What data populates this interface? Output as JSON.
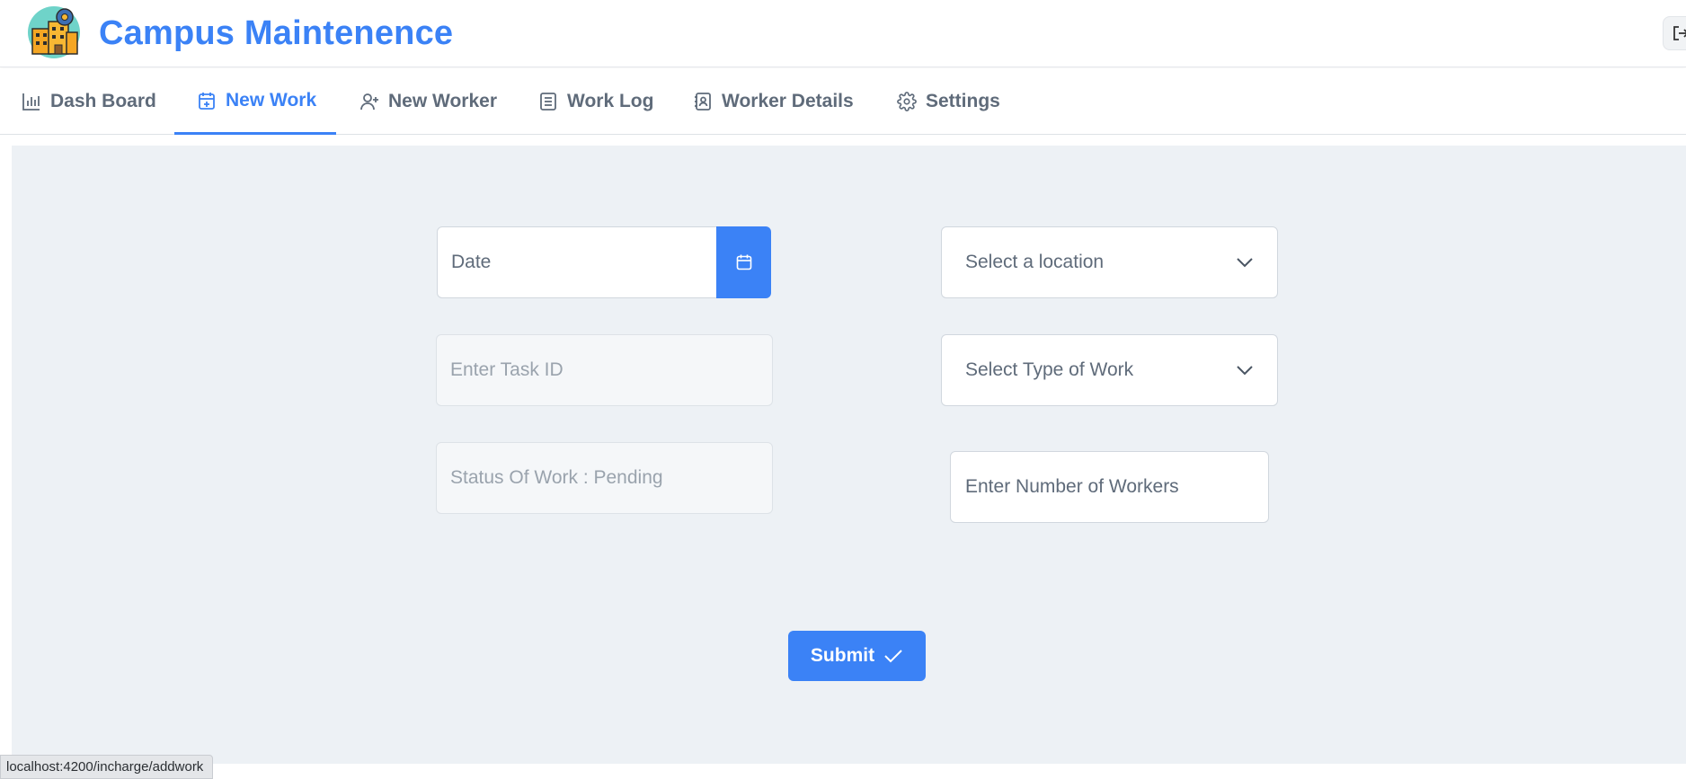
{
  "header": {
    "app_title": "Campus Maintenence",
    "logo_icon": "campus-building-gear-logo",
    "logout_icon": "logout-icon"
  },
  "tabs": [
    {
      "label": "Dash Board",
      "icon": "bar-chart-icon",
      "active": false
    },
    {
      "label": "New Work",
      "icon": "calendar-plus-icon",
      "active": true
    },
    {
      "label": "New Worker",
      "icon": "user-plus-icon",
      "active": false
    },
    {
      "label": "Work Log",
      "icon": "document-icon",
      "active": false
    },
    {
      "label": "Worker Details",
      "icon": "contact-book-icon",
      "active": false
    },
    {
      "label": "Settings",
      "icon": "gear-icon",
      "active": false
    }
  ],
  "form": {
    "date_placeholder": "Date",
    "task_id_placeholder": "Enter Task ID",
    "status_value": "Status Of Work : Pending",
    "location_placeholder": "Select a location",
    "work_type_placeholder": "Select Type of Work",
    "workers_placeholder": "Enter Number of Workers",
    "submit_label": "Submit"
  },
  "statusbar": {
    "url": "localhost:4200/incharge/addwork"
  },
  "colors": {
    "accent": "#3b82f6",
    "panel_bg": "#edf1f5",
    "text_muted": "#5f6b7a"
  }
}
